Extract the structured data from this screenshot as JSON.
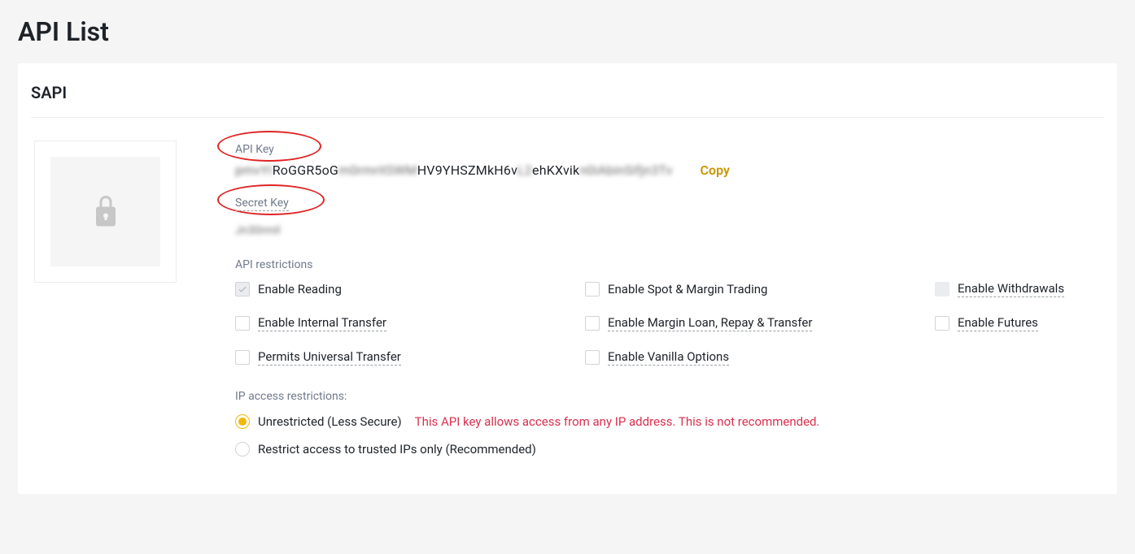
{
  "page": {
    "title": "API List"
  },
  "card": {
    "name": "SAPI",
    "apiKey": {
      "label": "API Key",
      "value_seg1": "pmvYI",
      "value_seg2": "RoGGR5oG",
      "value_seg3": "m0rmritSWM",
      "value_seg4": "HV9YHSZMkH6v",
      "value_seg5": "L2",
      "value_seg6": "ehKXvik",
      "value_seg7": "n0iAbinSifjn3Tv",
      "copy": "Copy"
    },
    "secretKey": {
      "label": "Secret Key",
      "value": "Jn30rmII"
    },
    "restrictionsTitle": "API restrictions",
    "restrictions": [
      {
        "label": "Enable Reading",
        "state": "checked-disabled",
        "underline": false
      },
      {
        "label": "Enable Spot & Margin Trading",
        "state": "unchecked",
        "underline": false
      },
      {
        "label": "Enable Withdrawals",
        "state": "disabled-empty",
        "underline": true
      },
      {
        "label": "Enable Internal Transfer",
        "state": "unchecked",
        "underline": true
      },
      {
        "label": "Enable Margin Loan, Repay & Transfer",
        "state": "unchecked",
        "underline": true
      },
      {
        "label": "Enable Futures",
        "state": "unchecked",
        "underline": true
      },
      {
        "label": "Permits Universal Transfer",
        "state": "unchecked",
        "underline": true
      },
      {
        "label": "Enable Vanilla Options",
        "state": "unchecked",
        "underline": true
      }
    ],
    "ipTitle": "IP access restrictions:",
    "ipOptions": {
      "unrestricted": {
        "label": "Unrestricted (Less Secure)",
        "warning": "This API key allows access from any IP address. This is not recommended."
      },
      "restricted": {
        "label": "Restrict access to trusted IPs only (Recommended)"
      }
    }
  }
}
